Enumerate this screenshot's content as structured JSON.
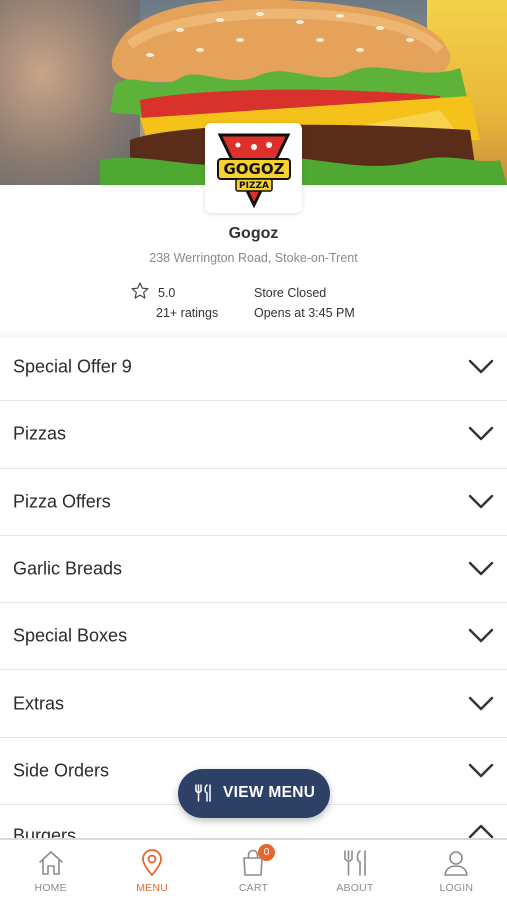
{
  "hero": {
    "image": "burger-photo",
    "logo_text_top": "GOGOZ",
    "logo_text_bottom": "PIZZA"
  },
  "store": {
    "name": "Gogoz",
    "address": "238 Werrington Road, Stoke-on-Trent",
    "rating": "5.0",
    "ratings_count": "21+ ratings",
    "status": "Store Closed",
    "opens": "Opens at 3:45 PM"
  },
  "categories": [
    {
      "label": "Special Offer 9"
    },
    {
      "label": "Pizzas"
    },
    {
      "label": "Pizza Offers"
    },
    {
      "label": "Garlic Breads"
    },
    {
      "label": "Special Boxes"
    },
    {
      "label": "Extras"
    },
    {
      "label": "Side Orders"
    },
    {
      "label": "Burgers"
    }
  ],
  "view_menu": {
    "label": "VIEW MENU",
    "icon": "cutlery-icon"
  },
  "nav": {
    "items": [
      {
        "label": "HOME",
        "icon": "home-icon"
      },
      {
        "label": "MENU",
        "icon": "location-pin-icon"
      },
      {
        "label": "CART",
        "icon": "shopping-bag-icon"
      },
      {
        "label": "ABOUT",
        "icon": "cutlery-icon"
      },
      {
        "label": "LOGIN",
        "icon": "user-icon"
      }
    ],
    "active": "MENU",
    "cart_count": "0"
  },
  "colors": {
    "accent": "#e8662e",
    "button": "#2d4166",
    "text": "#2b2b2b",
    "muted": "#8a8a8a"
  }
}
